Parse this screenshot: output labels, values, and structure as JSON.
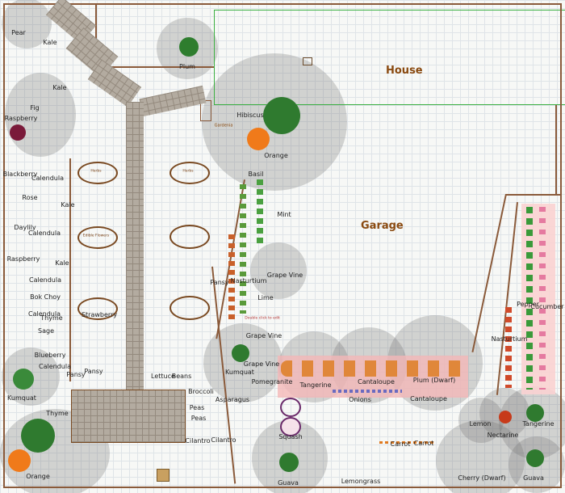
{
  "areas": {
    "house": "House",
    "garage": "Garage"
  },
  "bed_labels": {
    "herbs_1": "Herbs",
    "herbs_2": "Herbs",
    "edible_flowers": "Edible Flowers",
    "double_click": "Double click to edit"
  },
  "trees": {
    "pear": "Pear",
    "plum": "Plum",
    "fig": "Fig",
    "orange_top": "Orange",
    "hibiscus": "Hibiscus",
    "kumquat_left": "Kumquat",
    "orange_bottom": "Orange",
    "kumquat_center": "Kumquat",
    "guava_bottom": "Guava",
    "cherry": "Cherry (Dwarf)",
    "guava_right": "Guava",
    "plum_dwarf": "Plum (Dwarf)",
    "lemon": "Lemon",
    "nectarine": "Nectarine",
    "tangerine_right": "Tangerine",
    "lime": "Lime",
    "pomegranite": "Pomegranite",
    "gardenia": "Gardenia"
  },
  "plants": {
    "kale_1": "Kale",
    "kale_2": "Kale",
    "kale_3": "Kale",
    "kale_4": "Kale",
    "raspberry_1": "Raspberry",
    "raspberry_2": "Raspberry",
    "blackberry": "Blackberry",
    "calendula_1": "Calendula",
    "calendula_2": "Calendula",
    "calendula_3": "Calendula",
    "calendula_4": "Calendula",
    "calendula_5": "Calendula",
    "rose": "Rose",
    "daylily": "Daylily",
    "bok_choy": "Bok Choy",
    "thyme_1": "Thyme",
    "thyme_2": "Thyme",
    "sage": "Sage",
    "blueberry": "Blueberry",
    "pansy_1": "Pansy",
    "pansy_2": "Pansy",
    "pansy_3": "Pansy",
    "strawberry": "Strawberry",
    "basil": "Basil",
    "mint": "Mint",
    "nasturtium_1": "Nasturtium",
    "nasturtium_2": "Nasturtium",
    "grape_vine_1": "Grape Vine",
    "grape_vine_2": "Grape Vine",
    "grape_vine_3": "Grape Vine",
    "lettuce": "Lettuce",
    "beans": "Beans",
    "broccoli": "Broccoli",
    "asparagus": "Asparagus",
    "peas_1": "Peas",
    "peas_2": "Peas",
    "cilantro_1": "Cilantro",
    "cilantro_2": "Cilantro",
    "squash": "Squash",
    "tangerine": "Tangerine",
    "cantaloupe_1": "Cantaloupe",
    "cantaloupe_2": "Cantaloupe",
    "onions": "Onions",
    "carrot_1": "Carrot",
    "carrot_2": "Carrot",
    "lemongrass": "Lemongrass",
    "pepper": "Pepper",
    "cucumber": "Cucumber"
  },
  "colors": {
    "house_outline": "#3cb043",
    "bed_border": "#7a4a22",
    "label_brown": "#8a4a10",
    "raised_bed": "#f4b8b8",
    "canopy": "#8c8c8c"
  }
}
